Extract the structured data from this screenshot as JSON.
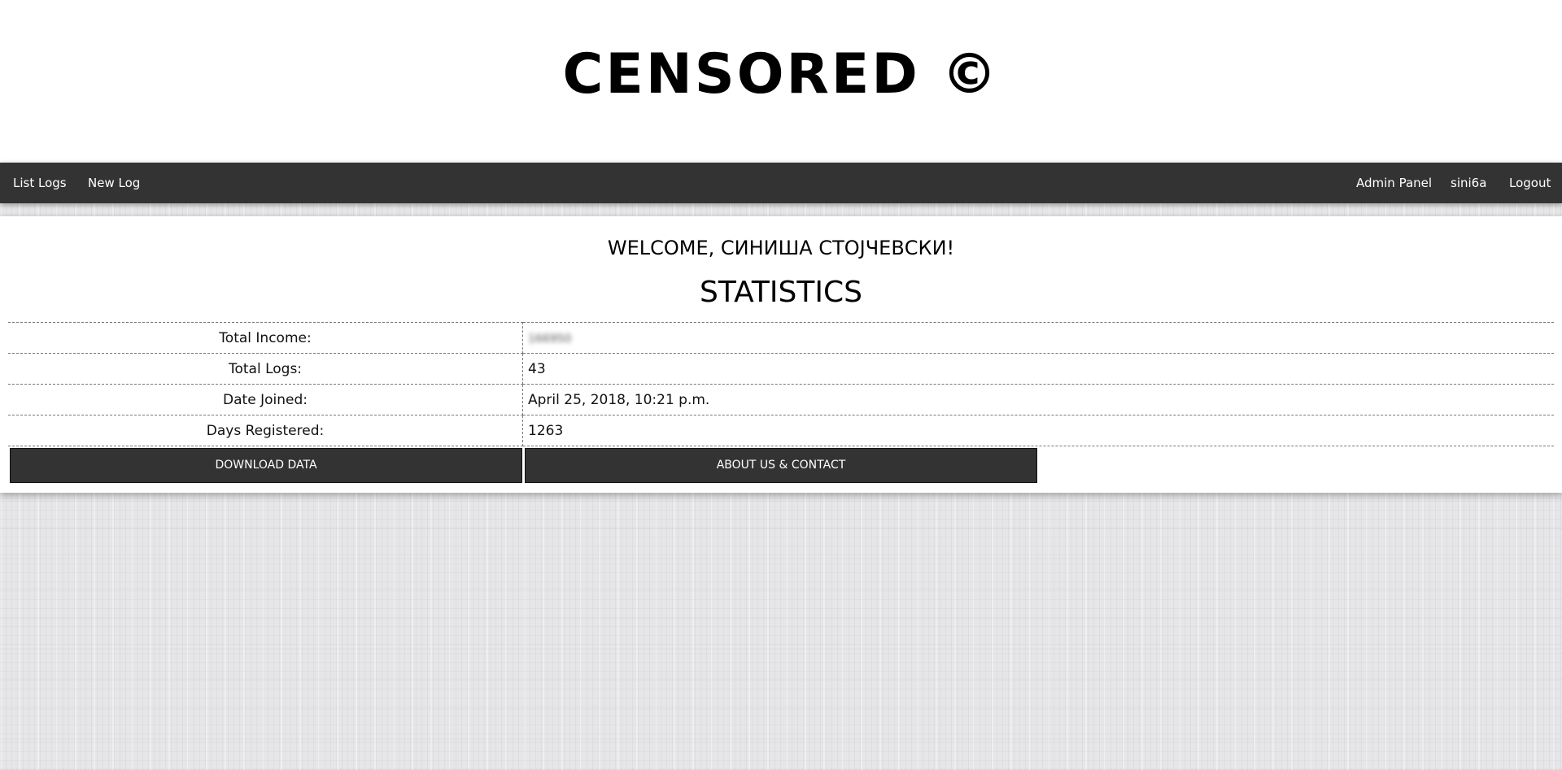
{
  "header": {
    "site_title": "CENSORED ©"
  },
  "nav": {
    "left": [
      "List Logs",
      "New Log"
    ],
    "right": [
      "Admin Panel",
      "sini6a",
      "Logout"
    ]
  },
  "main": {
    "welcome": "WELCOME, СИНИША СТОЈЧЕВСКИ!",
    "heading": "STATISTICS",
    "stats": [
      {
        "label": "Total Income:",
        "value": "166950"
      },
      {
        "label": "Total Logs:",
        "value": "43"
      },
      {
        "label": "Date Joined:",
        "value": "April 25, 2018, 10:21 p.m."
      },
      {
        "label": "Days Registered:",
        "value": "1263"
      }
    ],
    "buttons": {
      "download": "DOWNLOAD DATA",
      "about": "ABOUT US & CONTACT"
    }
  }
}
